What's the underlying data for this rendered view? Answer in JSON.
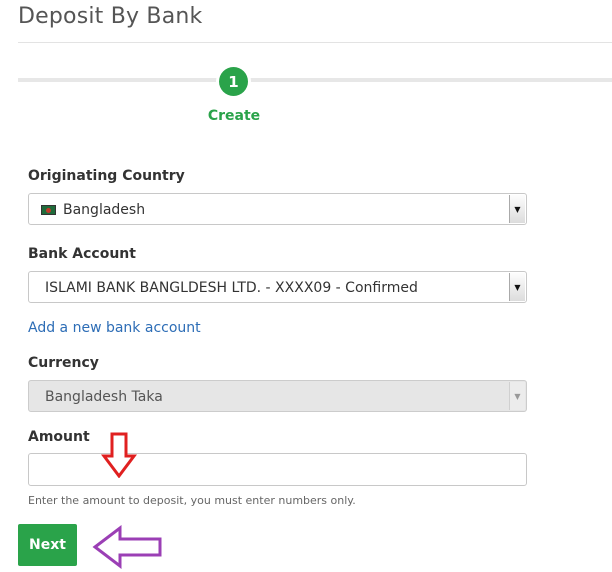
{
  "page": {
    "title": "Deposit By Bank"
  },
  "stepper": {
    "step_number": "1",
    "step_label": "Create",
    "accent_color": "#2aa34a"
  },
  "form": {
    "originating_country": {
      "label": "Originating Country",
      "value": "Bangladesh",
      "flag_icon": "bangladesh-flag-icon"
    },
    "bank_account": {
      "label": "Bank Account",
      "value": "ISLAMI BANK BANGLDESH LTD. - XXXX09 - Confirmed"
    },
    "add_bank_link": "Add a new bank account",
    "currency": {
      "label": "Currency",
      "value": "Bangladesh Taka",
      "disabled": true
    },
    "amount": {
      "label": "Amount",
      "value": "",
      "placeholder": "",
      "help": "Enter the amount to deposit, you must enter numbers only."
    },
    "next_label": "Next"
  },
  "annotations": {
    "down_arrow": {
      "icon": "down-arrow-annotation-icon",
      "color": "#e02020"
    },
    "left_arrow": {
      "icon": "left-arrow-annotation-icon",
      "color": "#9b3fb5"
    }
  }
}
